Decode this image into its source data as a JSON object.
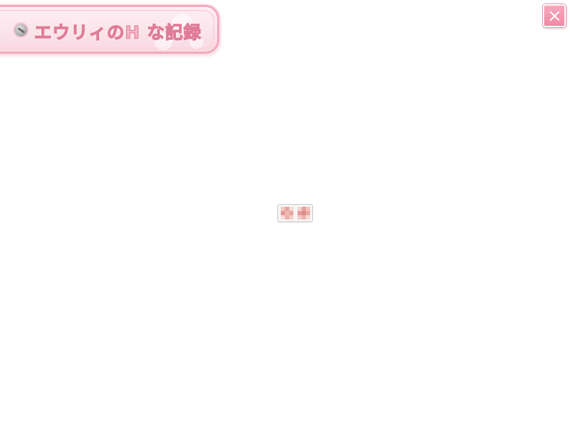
{
  "header": {
    "title": "エウリィのH な記録",
    "icon": "pen-icon"
  },
  "controls": {
    "close_icon": "close-icon",
    "accent_color": "#ee8aa5"
  },
  "main": {
    "entries": [
      {
        "thumbnail": "censored-mosaic-icon",
        "colors": [
          "#f2b7b0",
          "#e9a19b",
          "#f6d1cd",
          "#dc8e8b"
        ]
      }
    ]
  }
}
